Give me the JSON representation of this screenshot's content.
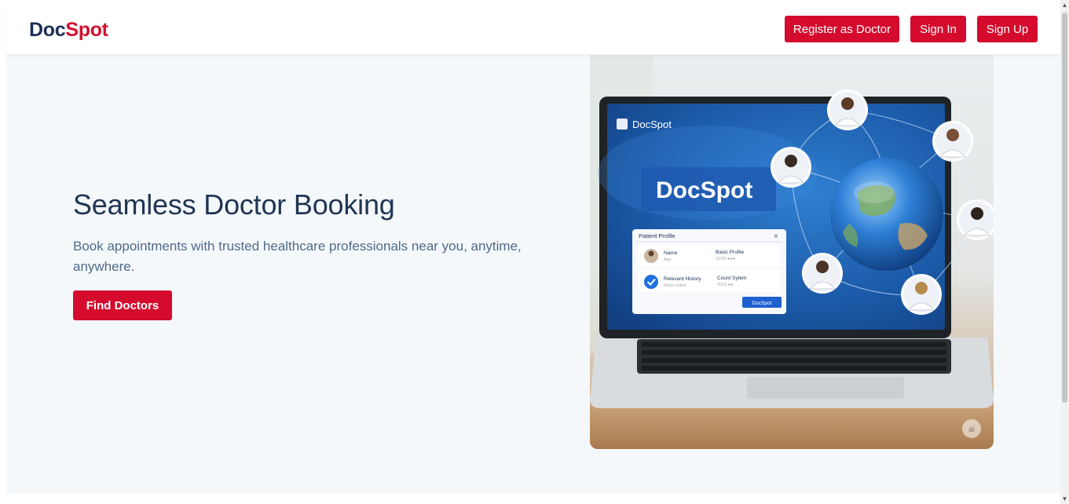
{
  "header": {
    "logo_part1": "Doc",
    "logo_part2": "Spot",
    "register_label": "Register as Doctor",
    "signin_label": "Sign In",
    "signup_label": "Sign Up"
  },
  "hero": {
    "title": "Seamless Doctor Booking",
    "subtitle": "Book appointments with trusted healthcare professionals near you, anytime, anywhere.",
    "cta_label": "Find Doctors",
    "image": {
      "screen_brand": "DocSpot",
      "screen_title": "DocSpot",
      "card_title": "Patient Profile",
      "card_close": "×",
      "row1_label": "Name",
      "row1_sub": "Age",
      "row1_right": "Basic Profile",
      "row1_right_sub": "10/30 ●●●",
      "row2_label": "Relevant History",
      "row2_sub": "None noted",
      "row2_right": "Count Sytem",
      "row2_right_sub": "2019 ●●",
      "card_button": "DocSpot",
      "watermark": "ai"
    }
  },
  "colors": {
    "brand_navy": "#1c2f57",
    "brand_red": "#d50b2d",
    "hero_bg": "#f5f8fb"
  }
}
